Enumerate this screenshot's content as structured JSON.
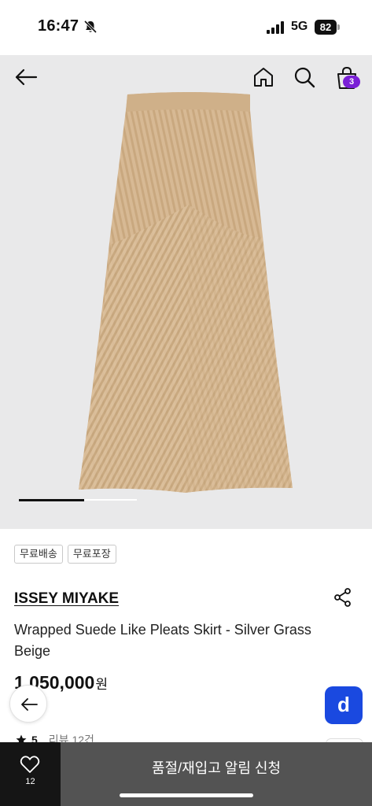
{
  "status_bar": {
    "time": "16:47",
    "network": "5G",
    "battery": "82"
  },
  "header": {
    "cart_count": "3",
    "icons": [
      "back-arrow-icon",
      "home-icon",
      "search-icon",
      "shopping-bag-icon"
    ]
  },
  "gallery": {
    "progress": 0.55,
    "colors": {
      "background": "#e9e9ea",
      "garment": "#d7b994"
    }
  },
  "tags": [
    "무료배송",
    "무료포장"
  ],
  "product": {
    "brand": "ISSEY MIYAKE",
    "name": "Wrapped Suede Like Pleats Skirt - Silver Grass Beige",
    "price": "1,050,000",
    "price_unit": "원"
  },
  "rating": {
    "score": "5",
    "reviews": "리뷰 12건"
  },
  "bottom_bar": {
    "wish_count": "12",
    "restock_label": "품절/재입고 알림 신청"
  },
  "colors": {
    "accent": "#1a49e0",
    "badge": "#7a1fd6",
    "bottom_dark": "#151515",
    "bottom_button": "#535353"
  }
}
